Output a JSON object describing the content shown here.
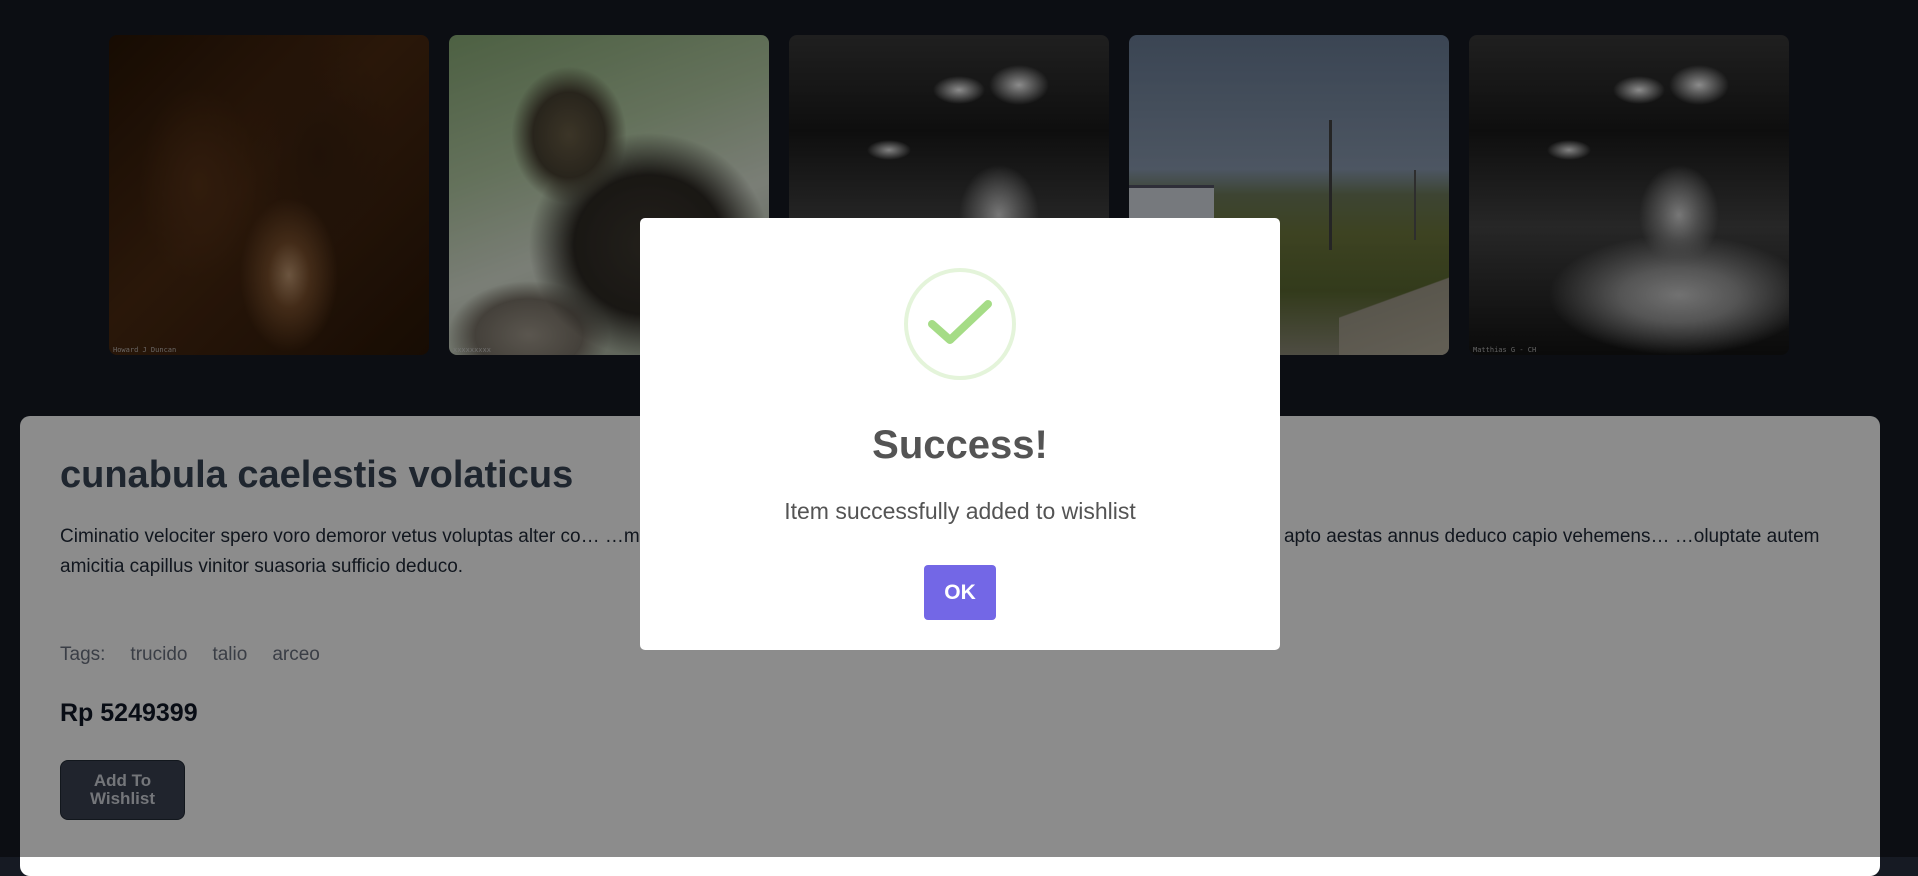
{
  "gallery": {
    "images": [
      {
        "alt": "abstract brown swirl",
        "credit": "Howard J Duncan"
      },
      {
        "alt": "tabby cat on cat tree",
        "credit": "xxxxxxxxx"
      },
      {
        "alt": "black and white shop vendor",
        "credit": ""
      },
      {
        "alt": "field with power lines",
        "credit": ""
      },
      {
        "alt": "black and white shop vendor",
        "credit": "Matthias G - CH"
      }
    ]
  },
  "product": {
    "title": "cunabula caelestis volaticus",
    "description": "Ciminatio velociter spero voro demoror vetus voluptas alter co… …mmisse decumbo virtus calculus vomito utroque bibo aufero aro. Adinventitias apto aestas annus deduco capio vehemens… …oluptate autem amicitia capillus vinitor suasoria sufficio deduco.",
    "tags_label": "Tags:",
    "tags": [
      "trucido",
      "talio",
      "arceo"
    ],
    "price": "Rp 5249399",
    "wishlist_button": "Add To Wishlist"
  },
  "modal": {
    "title": "Success!",
    "message": "Item successfully added to wishlist",
    "ok_button": "OK",
    "icon": "checkmark-icon",
    "accent": "#7367e6",
    "success_color": "#a5dc86"
  }
}
